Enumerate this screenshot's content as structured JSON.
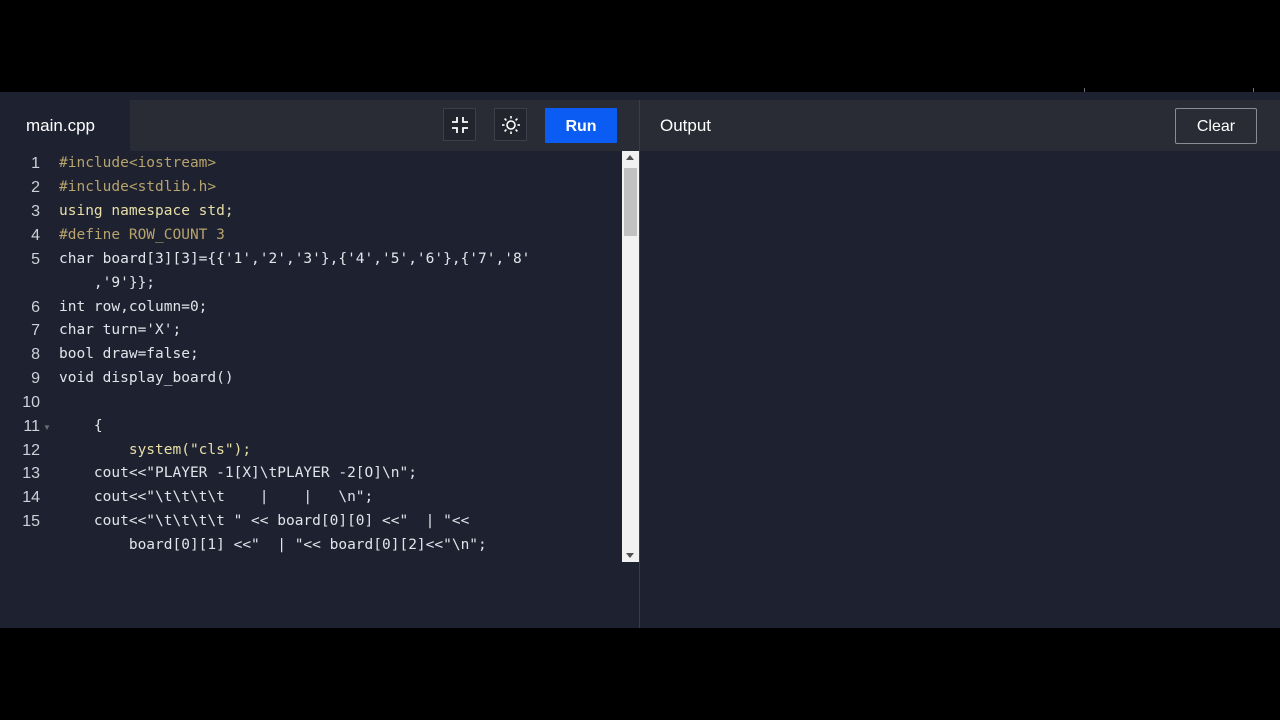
{
  "editor": {
    "tab_label": "main.cpp",
    "run_label": "Run",
    "fullscreen_icon": "fullscreen-exit-icon",
    "theme_icon": "sun-icon",
    "line_numbers": [
      "1",
      "2",
      "3",
      "4",
      "5",
      "6",
      "7",
      "8",
      "9",
      "10",
      "11",
      "12",
      "13",
      "14",
      "15"
    ],
    "lines": [
      "#include<iostream>",
      "#include<stdlib.h>",
      "using namespace std;",
      "#define ROW_COUNT 3",
      "char board[3][3]={{'1','2','3'},{'4','5','6'},{'7','8'",
      "    ,'9'}};",
      "int row,column=0;",
      "char turn='X';",
      "bool draw=false;",
      "void display_board()",
      "",
      "    {",
      "        system(\"cls\");",
      "    cout<<\"PLAYER -1[X]\\tPLAYER -2[O]\\n\";",
      "    cout<<\"\\t\\t\\t\\t    |    |   \\n\";",
      "    cout<<\"\\t\\t\\t\\t \" << board[0][0] <<\"  | \"<<",
      "        board[0][1] <<\"  | \"<< board[0][2]<<\"\\n\";"
    ]
  },
  "output": {
    "title": "Output",
    "clear_label": "Clear",
    "content": ""
  },
  "colors": {
    "run_button": "#0b5cf2",
    "background": "#1e2130",
    "header": "#2a2c35"
  }
}
